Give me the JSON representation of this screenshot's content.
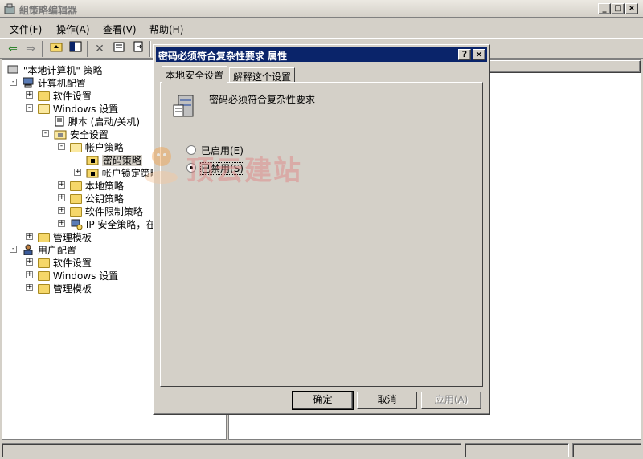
{
  "window": {
    "title": "組策略编辑器",
    "controls": [
      "_",
      "□",
      "×"
    ]
  },
  "menu": [
    {
      "label": "文件(F)"
    },
    {
      "label": "操作(A)"
    },
    {
      "label": "查看(V)"
    },
    {
      "label": "帮助(H)"
    }
  ],
  "tree": [
    {
      "label": "\"本地计算机\" 策略"
    },
    {
      "label": "计算机配置"
    },
    {
      "label": "软件设置"
    },
    {
      "label": "Windows 设置"
    },
    {
      "label": "脚本 (启动/关机)"
    },
    {
      "label": "安全设置"
    },
    {
      "label": "帐户策略"
    },
    {
      "label": "密码策略"
    },
    {
      "label": "帐户锁定策略"
    },
    {
      "label": "本地策略"
    },
    {
      "label": "公钥策略"
    },
    {
      "label": "软件限制策略"
    },
    {
      "label": "IP 安全策略，在"
    },
    {
      "label": "管理模板"
    },
    {
      "label": "用户配置"
    },
    {
      "label": "软件设置"
    },
    {
      "label": "Windows 设置"
    },
    {
      "label": "管理模板"
    }
  ],
  "dialog": {
    "title": "密码必须符合复杂性要求 属性",
    "help_button": "?",
    "close_button": "×",
    "tabs": [
      {
        "label": "本地安全设置"
      },
      {
        "label": "解释这个设置"
      }
    ],
    "policy_name": "密码必须符合复杂性要求",
    "options": [
      {
        "label": "已启用(E)",
        "checked": false
      },
      {
        "label": "已禁用(S)",
        "checked": true
      }
    ],
    "ok_label": "确定",
    "cancel_label": "取消",
    "apply_label": "应用(A)"
  },
  "watermark": {
    "text": "顶云建站"
  }
}
